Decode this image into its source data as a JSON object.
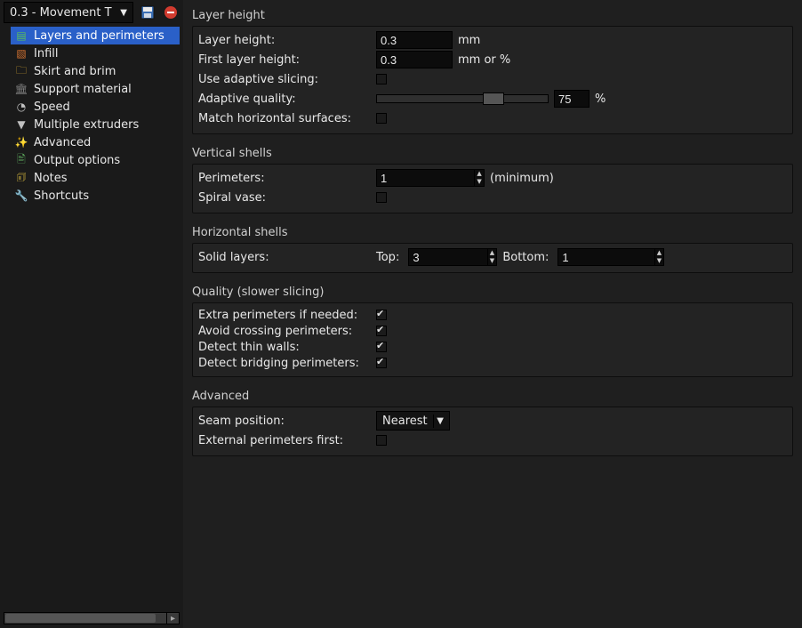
{
  "header": {
    "profile": "0.3 - Movement T"
  },
  "sidebar": {
    "items": [
      {
        "label": "Layers and perimeters",
        "icon": "layers-icon",
        "glyph": "▤",
        "color": "#5bbf5b",
        "selected": true
      },
      {
        "label": "Infill",
        "icon": "infill-icon",
        "glyph": "▧",
        "color": "#d07030",
        "selected": false
      },
      {
        "label": "Skirt and brim",
        "icon": "skirt-brim-icon",
        "glyph": "🗀",
        "color": "#d0a030",
        "selected": false
      },
      {
        "label": "Support material",
        "icon": "support-icon",
        "glyph": "🏛",
        "color": "#808080",
        "selected": false
      },
      {
        "label": "Speed",
        "icon": "speed-icon",
        "glyph": "◔",
        "color": "#c0c0c0",
        "selected": false
      },
      {
        "label": "Multiple extruders",
        "icon": "extruders-icon",
        "glyph": "▼",
        "color": "#c0c0c0",
        "selected": false
      },
      {
        "label": "Advanced",
        "icon": "advanced-icon",
        "glyph": "✨",
        "color": "#e0c040",
        "selected": false
      },
      {
        "label": "Output options",
        "icon": "output-icon",
        "glyph": "🖹",
        "color": "#60b060",
        "selected": false
      },
      {
        "label": "Notes",
        "icon": "notes-icon",
        "glyph": "🗊",
        "color": "#e0c040",
        "selected": false
      },
      {
        "label": "Shortcuts",
        "icon": "shortcuts-icon",
        "glyph": "🔧",
        "color": "#c0c0c0",
        "selected": false
      }
    ]
  },
  "settings": {
    "layer_height": {
      "title": "Layer height",
      "layer_height_label": "Layer height:",
      "layer_height_value": "0.3",
      "layer_height_unit": "mm",
      "first_layer_label": "First layer height:",
      "first_layer_value": "0.3",
      "first_layer_unit": "mm or %",
      "adaptive_label": "Use adaptive slicing:",
      "adaptive_checked": false,
      "adaptive_quality_label": "Adaptive quality:",
      "adaptive_quality_value": "75",
      "adaptive_quality_unit": "%",
      "match_horizontal_label": "Match horizontal surfaces:",
      "match_horizontal_checked": false
    },
    "vertical_shells": {
      "title": "Vertical shells",
      "perimeters_label": "Perimeters:",
      "perimeters_value": "1",
      "perimeters_suffix": "(minimum)",
      "spiral_vase_label": "Spiral vase:",
      "spiral_vase_checked": false
    },
    "horizontal_shells": {
      "title": "Horizontal shells",
      "solid_layers_label": "Solid layers:",
      "top_label": "Top:",
      "top_value": "3",
      "bottom_label": "Bottom:",
      "bottom_value": "1"
    },
    "quality": {
      "title": "Quality (slower slicing)",
      "extra_perimeters_label": "Extra perimeters if needed:",
      "extra_perimeters_checked": true,
      "avoid_crossing_label": "Avoid crossing perimeters:",
      "avoid_crossing_checked": true,
      "detect_thin_walls_label": "Detect thin walls:",
      "detect_thin_walls_checked": true,
      "detect_bridging_label": "Detect bridging perimeters:",
      "detect_bridging_checked": true
    },
    "advanced": {
      "title": "Advanced",
      "seam_position_label": "Seam position:",
      "seam_position_value": "Nearest",
      "external_first_label": "External perimeters first:",
      "external_first_checked": false
    }
  }
}
